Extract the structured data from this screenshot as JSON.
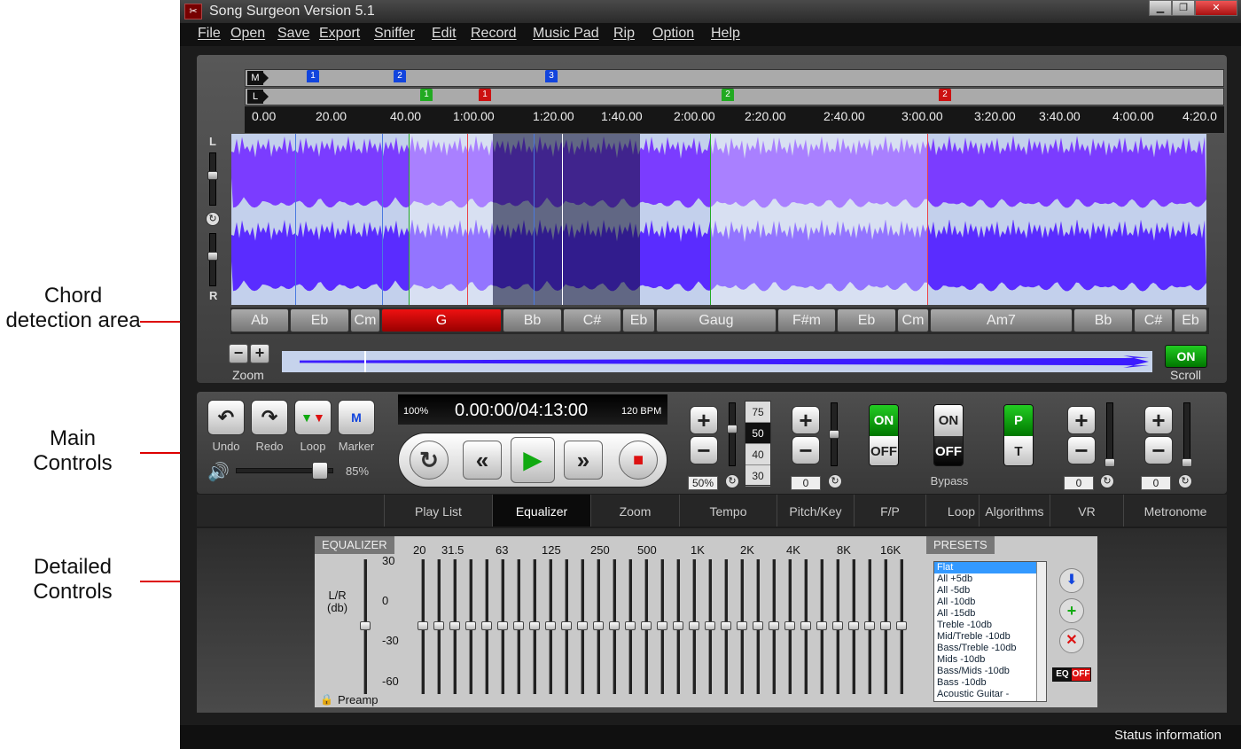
{
  "annotations": {
    "chord": "Chord detection area",
    "main": "Main Controls",
    "detailed": "Detailed Controls"
  },
  "window": {
    "title": "Song Surgeon Version 5.1",
    "min": "▁",
    "max": "❐",
    "close": "✕"
  },
  "menu": [
    "File",
    "Open",
    "Save",
    "Export",
    "Sniffer",
    "Edit",
    "Record",
    "Music Pad",
    "Rip",
    "Option",
    "Help"
  ],
  "ruler": {
    "row_m": "M",
    "row_l": "L",
    "ticks": [
      "0.00",
      "20.00",
      "40.00",
      "1:00.00",
      "1:20.00",
      "1:40.00",
      "2:00.00",
      "2:20.00",
      "2:40.00",
      "3:00.00",
      "3:20.00",
      "3:40.00",
      "4:00.00",
      "4:20.0"
    ],
    "m_markers": [
      "1",
      "2",
      "3"
    ],
    "l_markers": [
      "1",
      "1",
      "2",
      "2"
    ]
  },
  "channels": {
    "left": "L",
    "right": "R",
    "reset": "↻"
  },
  "chords": [
    "Ab",
    "Eb",
    "Cm",
    "G",
    "Bb",
    "C#",
    "Eb",
    "Gaug",
    "F#m",
    "Eb",
    "Cm",
    "Am7",
    "Bb",
    "C#",
    "Eb"
  ],
  "active_chord": "G",
  "zoom": {
    "minus": "−",
    "plus": "+",
    "label": "Zoom"
  },
  "scroll": {
    "state": "ON",
    "label": "Scroll"
  },
  "main_controls": {
    "undo": "Undo",
    "redo": "Redo",
    "loop": "Loop",
    "marker": "Marker",
    "volume": "85%",
    "volume_level": 0.85,
    "speed": "100%",
    "time": "0.00:00/04:13:00",
    "bpm": "120 BPM"
  },
  "tempo": {
    "values": [
      "75",
      "50",
      "40",
      "30"
    ],
    "selected": "50",
    "percent": "50%"
  },
  "pitch": {
    "value": "0"
  },
  "fp": {
    "on": "ON",
    "off": "OFF"
  },
  "loop_toggle": {
    "on": "ON",
    "off": "OFF",
    "label": "Bypass"
  },
  "algorithms": {
    "p": "P",
    "t": "T"
  },
  "vr": {
    "value": "0"
  },
  "metronome": {
    "value": "0"
  },
  "tabs": [
    "Play List",
    "Equalizer",
    "Zoom",
    "Tempo",
    "Pitch/Key",
    "F/P",
    "Loop",
    "Algorithms",
    "VR",
    "Metronome"
  ],
  "selected_tab": "Equalizer",
  "equalizer": {
    "header": "EQUALIZER",
    "lr_label": "L/R",
    "db_label": "(db)",
    "scale": [
      "30",
      "0",
      "-30",
      "-60"
    ],
    "bands": [
      "20",
      "31.5",
      "63",
      "125",
      "250",
      "500",
      "1K",
      "2K",
      "4K",
      "8K",
      "16K"
    ],
    "preamp": "Preamp"
  },
  "presets": {
    "header": "PRESETS",
    "items": [
      "Flat",
      "All +5db",
      "All -5db",
      "All -10db",
      "All -15db",
      "Treble -10db",
      "Mid/Treble -10db",
      "Bass/Treble -10db",
      "Mids -10db",
      "Bass/Mids -10db",
      "Bass -10db",
      "Acoustic Guitar -"
    ],
    "eq_toggle": "EQ",
    "eq_state": "OFF"
  },
  "status": "Status information",
  "colors": {
    "wave": "#7b40ff",
    "active_chord": "#dd1111",
    "scroll_on": "#1a9a1a",
    "blue_marker": "#1144dd",
    "green_marker": "#22aa22",
    "red_marker": "#cc1111"
  }
}
